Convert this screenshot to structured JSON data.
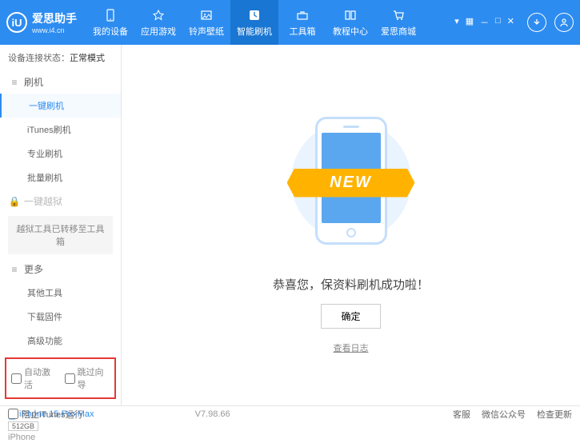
{
  "header": {
    "logo_letters": "iU",
    "title": "爱思助手",
    "url": "www.i4.cn",
    "nav": [
      {
        "label": "我的设备"
      },
      {
        "label": "应用游戏"
      },
      {
        "label": "铃声壁纸"
      },
      {
        "label": "智能刷机"
      },
      {
        "label": "工具箱"
      },
      {
        "label": "教程中心"
      },
      {
        "label": "爱思商城"
      }
    ]
  },
  "sidebar": {
    "status_label": "设备连接状态：",
    "status_value": "正常模式",
    "section_flash": "刷机",
    "items_flash": [
      "一键刷机",
      "iTunes刷机",
      "专业刷机",
      "批量刷机"
    ],
    "section_jailbreak": "一键越狱",
    "jailbreak_note": "越狱工具已转移至工具箱",
    "section_more": "更多",
    "items_more": [
      "其他工具",
      "下载固件",
      "高级功能"
    ],
    "cb_auto": "自动激活",
    "cb_skip": "跳过向导",
    "device_name": "iPhone 15 Pro Max",
    "storage": "512GB",
    "device_type": "iPhone"
  },
  "main": {
    "ribbon": "NEW",
    "success": "恭喜您，保资料刷机成功啦！",
    "ok": "确定",
    "log": "查看日志"
  },
  "footer": {
    "block_itunes": "阻止iTunes运行",
    "version": "V7.98.66",
    "links": [
      "客服",
      "微信公众号",
      "检查更新"
    ]
  }
}
